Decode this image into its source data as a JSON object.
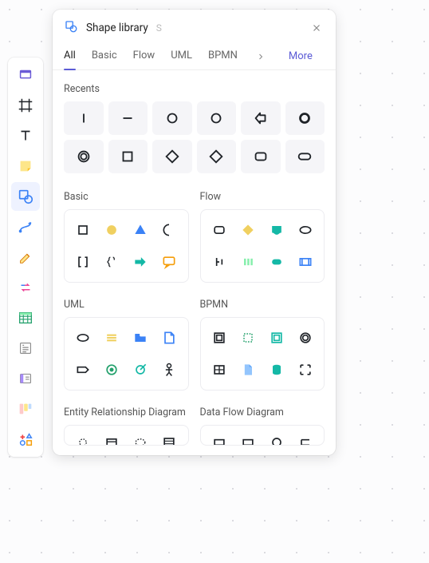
{
  "panel": {
    "title": "Shape library",
    "shortcut": "S",
    "tabs": [
      "All",
      "Basic",
      "Flow",
      "UML",
      "BPMN"
    ],
    "activeTab": "All",
    "more": "More",
    "sections": {
      "recents": {
        "label": "Recents"
      },
      "basic": {
        "label": "Basic"
      },
      "flow": {
        "label": "Flow"
      },
      "uml": {
        "label": "UML"
      },
      "bpmn": {
        "label": "BPMN"
      },
      "erd": {
        "label": "Entity Relationship Diagram"
      },
      "dfd": {
        "label": "Data Flow Diagram"
      }
    }
  },
  "toolbar": {
    "items": [
      "select-tool",
      "frame-tool",
      "text-tool",
      "sticky-note-tool",
      "shapes-tool",
      "connector-tool",
      "pen-tool",
      "swap-tool",
      "table-tool",
      "text-block-tool",
      "card-tool",
      "kanban-tool",
      "more-shapes-tool"
    ],
    "active": "shapes-tool"
  },
  "recents": [
    "line-vertical",
    "line-horizontal",
    "circle",
    "circle",
    "arrow-left",
    "circle-bold",
    "double-circle",
    "square",
    "diamond",
    "diamond",
    "rounded-rect",
    "pill"
  ],
  "groups": {
    "basic": [
      "square",
      "circle-filled",
      "triangle-filled",
      "crescent",
      "brackets",
      "braces",
      "arrow-right-filled",
      "callout"
    ],
    "flow": [
      "rounded-rect",
      "diamond-filled",
      "document-filled",
      "ellipse",
      "indent",
      "parallel",
      "capsule",
      "subroutine"
    ],
    "uml": [
      "ellipse",
      "menu-lines",
      "folder-filled",
      "page-fold",
      "label-tag",
      "circle-dot",
      "target-arrow",
      "actor"
    ],
    "bpmn": [
      "square-inner",
      "square-dashed",
      "square-double",
      "double-circle",
      "table-cell",
      "file",
      "cylinder",
      "expand"
    ],
    "erd_preview": [
      "gear",
      "card",
      "oval",
      "grid"
    ],
    "dfd_preview": [
      "rect",
      "rect",
      "circle",
      "bracket-box"
    ]
  },
  "colors": {
    "yellow": "#f0d060",
    "blue": "#3b82f6",
    "teal": "#14b8a6",
    "green": "#22a06b",
    "dark": "#1f2328"
  }
}
